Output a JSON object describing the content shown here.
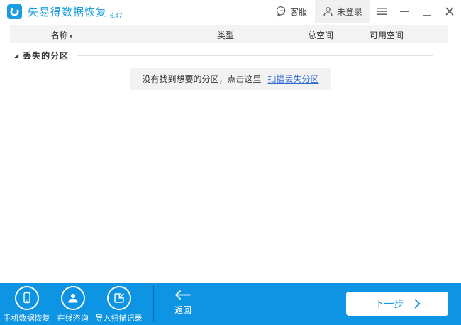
{
  "titlebar": {
    "app_title": "失易得数据恢复",
    "version": "6.47",
    "kefu_label": "客服",
    "login_label": "未登录"
  },
  "table_header": {
    "columns": [
      "名称",
      "类型",
      "总空间",
      "可用空间"
    ]
  },
  "section": {
    "label": "丢失的分区"
  },
  "empty_message": {
    "text": "没有找到想要的分区，点击这里",
    "link": "扫描丢失分区"
  },
  "bottombar": {
    "tools": [
      {
        "icon": "phone-recovery-icon",
        "label": "手机数据恢复"
      },
      {
        "icon": "online-consult-icon",
        "label": "在线咨询"
      },
      {
        "icon": "import-records-icon",
        "label": "导入扫描记录"
      }
    ],
    "back_label": "返回",
    "next_label": "下一步"
  },
  "icons": {
    "name_sort_arrow": "▾",
    "section_expand": "◢"
  },
  "colors": {
    "brand_blue": "#1b9ce0",
    "bar_blue": "#0d94e2",
    "link_blue": "#2d68d8",
    "next_blue": "#1a95dc"
  }
}
